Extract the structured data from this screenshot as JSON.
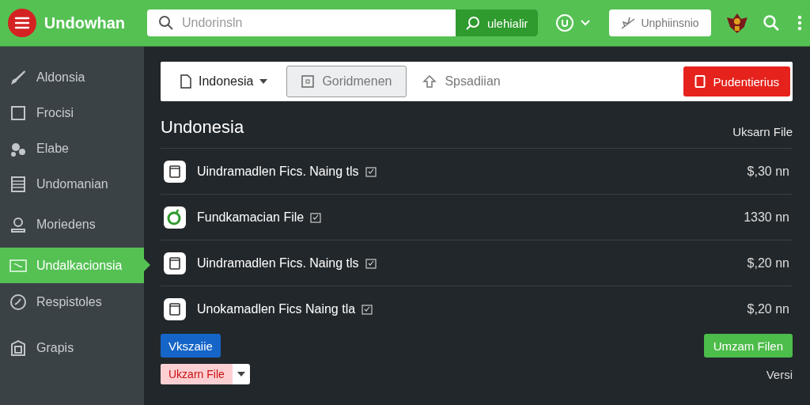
{
  "header": {
    "app_name": "Undowhan",
    "search": {
      "placeholder": "Undorinsln"
    },
    "search_button": "ulehialir",
    "action_button": "Unphiinsnio"
  },
  "sidebar": {
    "items": [
      {
        "label": "Aldonsia",
        "selected": false
      },
      {
        "label": "Frocisi",
        "selected": false
      },
      {
        "label": "Elabe",
        "selected": false
      },
      {
        "label": "Undomanian",
        "selected": false
      },
      {
        "label": "Moriedens",
        "selected": false
      },
      {
        "label": "Undalkacionsia",
        "selected": true
      },
      {
        "label": "Respistoles",
        "selected": false
      },
      {
        "label": "Grapis",
        "selected": false
      }
    ]
  },
  "toolbar": {
    "dropdown": "Indonesia",
    "buttons": [
      {
        "label": "Goridmenen",
        "kind": "outlined"
      },
      {
        "label": "Spsadiian",
        "kind": "plain"
      }
    ],
    "danger_button": "Pudentierius"
  },
  "section": {
    "title": "Undonesia",
    "side_label": "Uksarn File"
  },
  "files": [
    {
      "name": "Uindramadlen Fics. Naing tls",
      "size": "$,30 nn",
      "kind": "file"
    },
    {
      "name": "Fundkamacian File",
      "size": "1330 nn",
      "kind": "app"
    },
    {
      "name": "Uindramadlen Fics. Naing tls",
      "size": "$,20 nn",
      "kind": "file"
    },
    {
      "name": "Unokamadlen Fics Naing tla",
      "size": "$,20 nn",
      "kind": "file"
    }
  ],
  "actions": {
    "left": "Vkszaiie",
    "right": "Umzam Filen"
  },
  "footer": {
    "split_button": "Ukzarn File",
    "version": "Versi"
  }
}
